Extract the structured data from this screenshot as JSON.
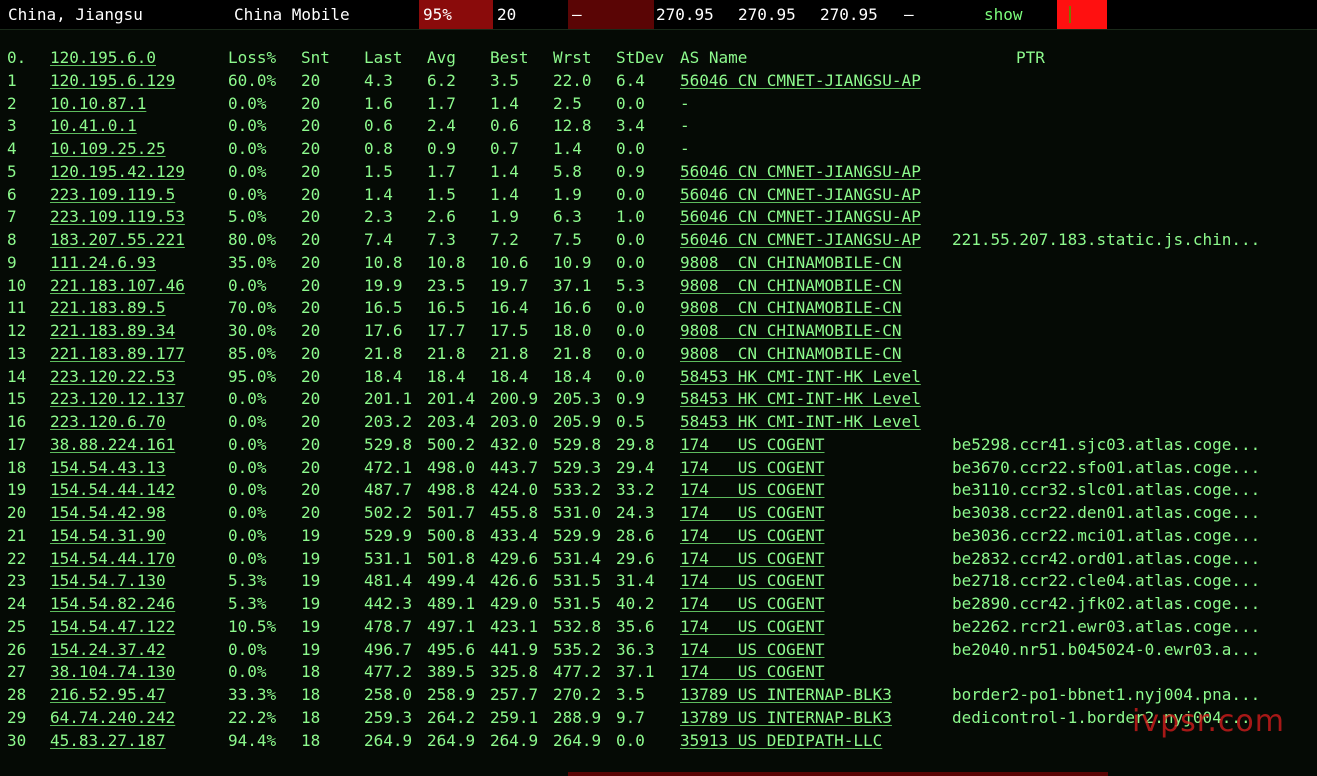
{
  "topbar": {
    "location": "China, Jiangsu",
    "isp": "China Mobile",
    "loss": "95%",
    "sent": "20",
    "dash1": "–",
    "v1": "270.95",
    "v2": "270.95",
    "v3": "270.95",
    "dash2": "–",
    "show_label": "show"
  },
  "table": {
    "headers": {
      "hop": "0.",
      "host": "120.195.6.0",
      "loss": "Loss%",
      "snt": "Snt",
      "last": "Last",
      "avg": "Avg",
      "best": "Best",
      "wrst": "Wrst",
      "stdev": "StDev",
      "as": "AS Name",
      "ptr": "PTR"
    },
    "rows": [
      {
        "hop": "1",
        "host": "120.195.6.129",
        "loss": "60.0%",
        "snt": "20",
        "last": "4.3",
        "avg": "6.2",
        "best": "3.5",
        "wrst": "22.0",
        "stdev": "6.4",
        "as": "56046 CN CMNET-JIANGSU-AP",
        "ptr": ""
      },
      {
        "hop": "2",
        "host": "10.10.87.1",
        "loss": "0.0%",
        "snt": "20",
        "last": "1.6",
        "avg": "1.7",
        "best": "1.4",
        "wrst": "2.5",
        "stdev": "0.0",
        "as": "-",
        "ptr": ""
      },
      {
        "hop": "3",
        "host": "10.41.0.1",
        "loss": "0.0%",
        "snt": "20",
        "last": "0.6",
        "avg": "2.4",
        "best": "0.6",
        "wrst": "12.8",
        "stdev": "3.4",
        "as": "-",
        "ptr": ""
      },
      {
        "hop": "4",
        "host": "10.109.25.25",
        "loss": "0.0%",
        "snt": "20",
        "last": "0.8",
        "avg": "0.9",
        "best": "0.7",
        "wrst": "1.4",
        "stdev": "0.0",
        "as": "-",
        "ptr": ""
      },
      {
        "hop": "5",
        "host": "120.195.42.129",
        "loss": "0.0%",
        "snt": "20",
        "last": "1.5",
        "avg": "1.7",
        "best": "1.4",
        "wrst": "5.8",
        "stdev": "0.9",
        "as": "56046 CN CMNET-JIANGSU-AP",
        "ptr": ""
      },
      {
        "hop": "6",
        "host": "223.109.119.5",
        "loss": "0.0%",
        "snt": "20",
        "last": "1.4",
        "avg": "1.5",
        "best": "1.4",
        "wrst": "1.9",
        "stdev": "0.0",
        "as": "56046 CN CMNET-JIANGSU-AP",
        "ptr": ""
      },
      {
        "hop": "7",
        "host": "223.109.119.53",
        "loss": "5.0%",
        "snt": "20",
        "last": "2.3",
        "avg": "2.6",
        "best": "1.9",
        "wrst": "6.3",
        "stdev": "1.0",
        "as": "56046 CN CMNET-JIANGSU-AP",
        "ptr": ""
      },
      {
        "hop": "8",
        "host": "183.207.55.221",
        "loss": "80.0%",
        "snt": "20",
        "last": "7.4",
        "avg": "7.3",
        "best": "7.2",
        "wrst": "7.5",
        "stdev": "0.0",
        "as": "56046 CN CMNET-JIANGSU-AP",
        "ptr": "221.55.207.183.static.js.chin..."
      },
      {
        "hop": "9",
        "host": "111.24.6.93",
        "loss": "35.0%",
        "snt": "20",
        "last": "10.8",
        "avg": "10.8",
        "best": "10.6",
        "wrst": "10.9",
        "stdev": "0.0",
        "as": "9808  CN CHINAMOBILE-CN",
        "ptr": ""
      },
      {
        "hop": "10",
        "host": "221.183.107.46",
        "loss": "0.0%",
        "snt": "20",
        "last": "19.9",
        "avg": "23.5",
        "best": "19.7",
        "wrst": "37.1",
        "stdev": "5.3",
        "as": "9808  CN CHINAMOBILE-CN",
        "ptr": ""
      },
      {
        "hop": "11",
        "host": "221.183.89.5",
        "loss": "70.0%",
        "snt": "20",
        "last": "16.5",
        "avg": "16.5",
        "best": "16.4",
        "wrst": "16.6",
        "stdev": "0.0",
        "as": "9808  CN CHINAMOBILE-CN",
        "ptr": ""
      },
      {
        "hop": "12",
        "host": "221.183.89.34",
        "loss": "30.0%",
        "snt": "20",
        "last": "17.6",
        "avg": "17.7",
        "best": "17.5",
        "wrst": "18.0",
        "stdev": "0.0",
        "as": "9808  CN CHINAMOBILE-CN",
        "ptr": ""
      },
      {
        "hop": "13",
        "host": "221.183.89.177",
        "loss": "85.0%",
        "snt": "20",
        "last": "21.8",
        "avg": "21.8",
        "best": "21.8",
        "wrst": "21.8",
        "stdev": "0.0",
        "as": "9808  CN CHINAMOBILE-CN",
        "ptr": ""
      },
      {
        "hop": "14",
        "host": "223.120.22.53",
        "loss": "95.0%",
        "snt": "20",
        "last": "18.4",
        "avg": "18.4",
        "best": "18.4",
        "wrst": "18.4",
        "stdev": "0.0",
        "as": "58453 HK CMI-INT-HK Level",
        "ptr": ""
      },
      {
        "hop": "15",
        "host": "223.120.12.137",
        "loss": "0.0%",
        "snt": "20",
        "last": "201.1",
        "avg": "201.4",
        "best": "200.9",
        "wrst": "205.3",
        "stdev": "0.9",
        "as": "58453 HK CMI-INT-HK Level",
        "ptr": ""
      },
      {
        "hop": "16",
        "host": "223.120.6.70",
        "loss": "0.0%",
        "snt": "20",
        "last": "203.2",
        "avg": "203.4",
        "best": "203.0",
        "wrst": "205.9",
        "stdev": "0.5",
        "as": "58453 HK CMI-INT-HK Level",
        "ptr": ""
      },
      {
        "hop": "17",
        "host": "38.88.224.161",
        "loss": "0.0%",
        "snt": "20",
        "last": "529.8",
        "avg": "500.2",
        "best": "432.0",
        "wrst": "529.8",
        "stdev": "29.8",
        "as": "174   US COGENT",
        "ptr": "be5298.ccr41.sjc03.atlas.coge..."
      },
      {
        "hop": "18",
        "host": "154.54.43.13",
        "loss": "0.0%",
        "snt": "20",
        "last": "472.1",
        "avg": "498.0",
        "best": "443.7",
        "wrst": "529.3",
        "stdev": "29.4",
        "as": "174   US COGENT",
        "ptr": "be3670.ccr22.sfo01.atlas.coge..."
      },
      {
        "hop": "19",
        "host": "154.54.44.142",
        "loss": "0.0%",
        "snt": "20",
        "last": "487.7",
        "avg": "498.8",
        "best": "424.0",
        "wrst": "533.2",
        "stdev": "33.2",
        "as": "174   US COGENT",
        "ptr": "be3110.ccr32.slc01.atlas.coge..."
      },
      {
        "hop": "20",
        "host": "154.54.42.98",
        "loss": "0.0%",
        "snt": "20",
        "last": "502.2",
        "avg": "501.7",
        "best": "455.8",
        "wrst": "531.0",
        "stdev": "24.3",
        "as": "174   US COGENT",
        "ptr": "be3038.ccr22.den01.atlas.coge..."
      },
      {
        "hop": "21",
        "host": "154.54.31.90",
        "loss": "0.0%",
        "snt": "19",
        "last": "529.9",
        "avg": "500.8",
        "best": "433.4",
        "wrst": "529.9",
        "stdev": "28.6",
        "as": "174   US COGENT",
        "ptr": "be3036.ccr22.mci01.atlas.coge..."
      },
      {
        "hop": "22",
        "host": "154.54.44.170",
        "loss": "0.0%",
        "snt": "19",
        "last": "531.1",
        "avg": "501.8",
        "best": "429.6",
        "wrst": "531.4",
        "stdev": "29.6",
        "as": "174   US COGENT",
        "ptr": "be2832.ccr42.ord01.atlas.coge..."
      },
      {
        "hop": "23",
        "host": "154.54.7.130",
        "loss": "5.3%",
        "snt": "19",
        "last": "481.4",
        "avg": "499.4",
        "best": "426.6",
        "wrst": "531.5",
        "stdev": "31.4",
        "as": "174   US COGENT",
        "ptr": "be2718.ccr22.cle04.atlas.coge..."
      },
      {
        "hop": "24",
        "host": "154.54.82.246",
        "loss": "5.3%",
        "snt": "19",
        "last": "442.3",
        "avg": "489.1",
        "best": "429.0",
        "wrst": "531.5",
        "stdev": "40.2",
        "as": "174   US COGENT",
        "ptr": "be2890.ccr42.jfk02.atlas.coge..."
      },
      {
        "hop": "25",
        "host": "154.54.47.122",
        "loss": "10.5%",
        "snt": "19",
        "last": "478.7",
        "avg": "497.1",
        "best": "423.1",
        "wrst": "532.8",
        "stdev": "35.6",
        "as": "174   US COGENT",
        "ptr": "be2262.rcr21.ewr03.atlas.coge..."
      },
      {
        "hop": "26",
        "host": "154.24.37.42",
        "loss": "0.0%",
        "snt": "19",
        "last": "496.7",
        "avg": "495.6",
        "best": "441.9",
        "wrst": "535.2",
        "stdev": "36.3",
        "as": "174   US COGENT",
        "ptr": "be2040.nr51.b045024-0.ewr03.a..."
      },
      {
        "hop": "27",
        "host": "38.104.74.130",
        "loss": "0.0%",
        "snt": "18",
        "last": "477.2",
        "avg": "389.5",
        "best": "325.8",
        "wrst": "477.2",
        "stdev": "37.1",
        "as": "174   US COGENT",
        "ptr": ""
      },
      {
        "hop": "28",
        "host": "216.52.95.47",
        "loss": "33.3%",
        "snt": "18",
        "last": "258.0",
        "avg": "258.9",
        "best": "257.7",
        "wrst": "270.2",
        "stdev": "3.5",
        "as": "13789 US INTERNAP-BLK3",
        "ptr": "border2-po1-bbnet1.nyj004.pna..."
      },
      {
        "hop": "29",
        "host": "64.74.240.242",
        "loss": "22.2%",
        "snt": "18",
        "last": "259.3",
        "avg": "264.2",
        "best": "259.1",
        "wrst": "288.9",
        "stdev": "9.7",
        "as": "13789 US INTERNAP-BLK3",
        "ptr": "dedicontrol-1.border2.nyj004..."
      },
      {
        "hop": "30",
        "host": "45.83.27.187",
        "loss": "94.4%",
        "snt": "18",
        "last": "264.9",
        "avg": "264.9",
        "best": "264.9",
        "wrst": "264.9",
        "stdev": "0.0",
        "as": "35913 US DEDIPATH-LLC",
        "ptr": ""
      }
    ]
  },
  "watermark": "ivpsr.com",
  "colors": {
    "text": "#8dfa8d",
    "accent_red": "#8a0b0b",
    "bright_red": "#ff1010",
    "background": "#050a05"
  }
}
